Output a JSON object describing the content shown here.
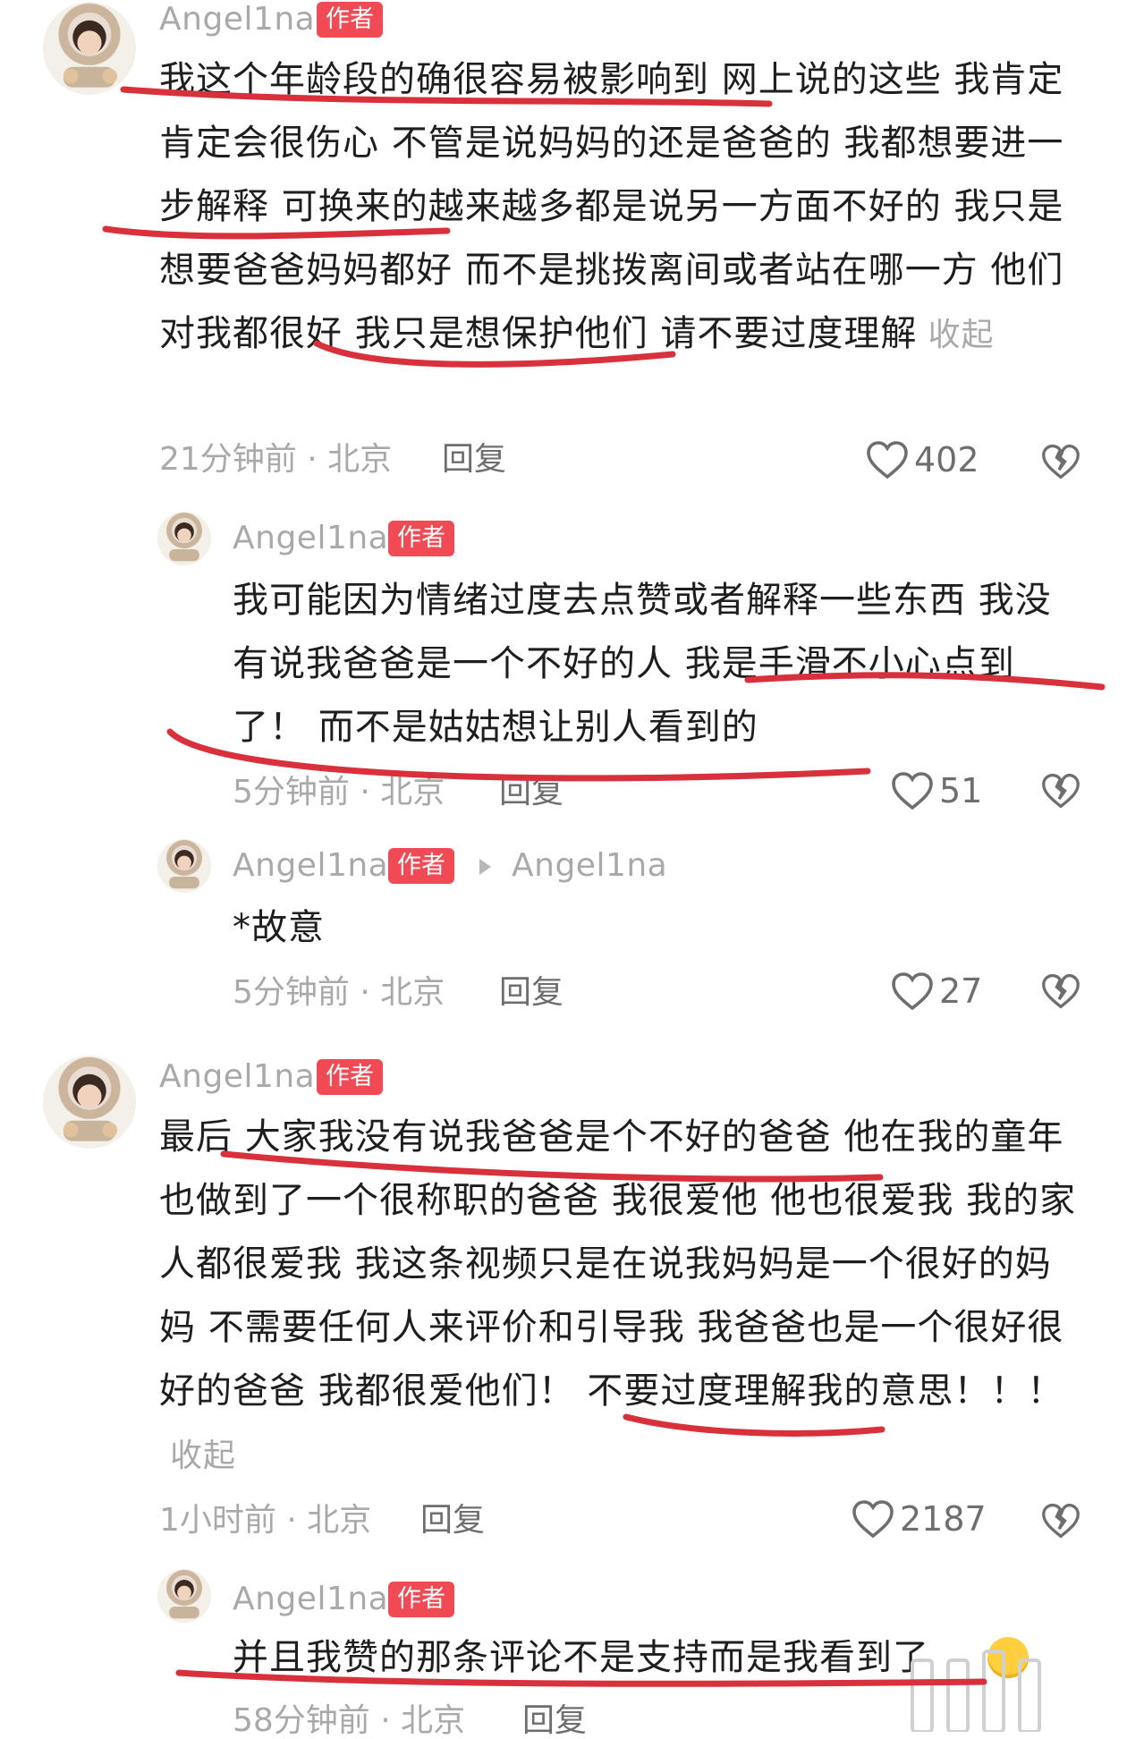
{
  "author_badge": "作者",
  "collapse_label": "收起",
  "comments": [
    {
      "username": "Angel1na",
      "text": "我这个年龄段的确很容易被影响到 网上说的这些 我肯定肯定会很伤心 不管是说妈妈的还是爸爸的 我都想要进一步解释 可换来的越来越多都是说另一方面不好的 我只是想要爸爸妈妈都好 而不是挑拨离间或者站在哪一方 他们对我都很好 我只是想保护他们 请不要过度理解",
      "meta": "21分钟前 · 北京",
      "reply_label": "回复",
      "likes": "402"
    },
    {
      "username": "Angel1na",
      "text": "我可能因为情绪过度去点赞或者解释一些东西 我没有说我爸爸是一个不好的人 我是手滑不小心点到了！ 而不是姑姑想让别人看到的",
      "meta": "5分钟前 · 北京",
      "reply_label": "回复",
      "likes": "51"
    },
    {
      "username": "Angel1na",
      "reply_to": "Angel1na",
      "text": "*故意",
      "meta": "5分钟前 · 北京",
      "reply_label": "回复",
      "likes": "27"
    },
    {
      "username": "Angel1na",
      "text": "最后 大家我没有说我爸爸是个不好的爸爸 他在我的童年也做到了一个很称职的爸爸 我很爱他 他也很爱我 我的家人都很爱我 我这条视频只是在说我妈妈是一个很好的妈妈 不需要任何人来评价和引导我 我爸爸也是一个很好很好的爸爸 我都很爱他们！ 不要过度理解我的意思！！！",
      "meta": "1小时前 · 北京",
      "reply_label": "回复",
      "likes": "2187"
    },
    {
      "username": "Angel1na",
      "text": "并且我赞的那条评论不是支持而是我看到了",
      "meta": "58分钟前 · 北京",
      "reply_label": "回复"
    }
  ],
  "colors": {
    "badge": "#f04a55",
    "underline": "#d8313b",
    "muted": "#a9a9a9"
  }
}
